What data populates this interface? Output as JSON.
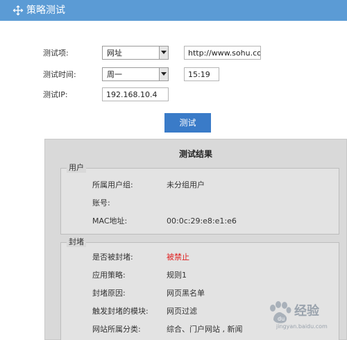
{
  "header": {
    "title": "策略测试",
    "icon": "move-icon"
  },
  "form": {
    "item_label": "测试项:",
    "item_select": "网址",
    "item_value": "http://www.sohu.com",
    "time_label": "测试时间:",
    "time_select": "周一",
    "time_value": "15:19",
    "ip_label": "测试IP:",
    "ip_value": "192.168.10.4",
    "test_button": "测试"
  },
  "results": {
    "title": "测试结果",
    "user_section": {
      "legend": "用户",
      "rows": [
        {
          "label": "所属用户组:",
          "value": "未分组用户"
        },
        {
          "label": "账号:",
          "value": ""
        },
        {
          "label": "MAC地址:",
          "value": "00:0c:29:e8:e1:e6"
        }
      ]
    },
    "block_section": {
      "legend": "封堵",
      "rows": [
        {
          "label": "是否被封堵:",
          "value": "被禁止"
        },
        {
          "label": "应用策略:",
          "value": "规则1"
        },
        {
          "label": "封堵原因:",
          "value": "网页黑名单"
        },
        {
          "label": "触发封堵的模块:",
          "value": "网页过滤"
        },
        {
          "label": "网站所属分类:",
          "value": "综合、门户网站 , 新闻"
        }
      ]
    },
    "blocked_color": "#e02020"
  },
  "watermark": {
    "text": "经验",
    "url": "jingyan.baidu.com"
  },
  "colors": {
    "header_bg": "#5b9bd5",
    "button_bg": "#3a7bc8",
    "panel_bg": "#d9d9d9"
  }
}
